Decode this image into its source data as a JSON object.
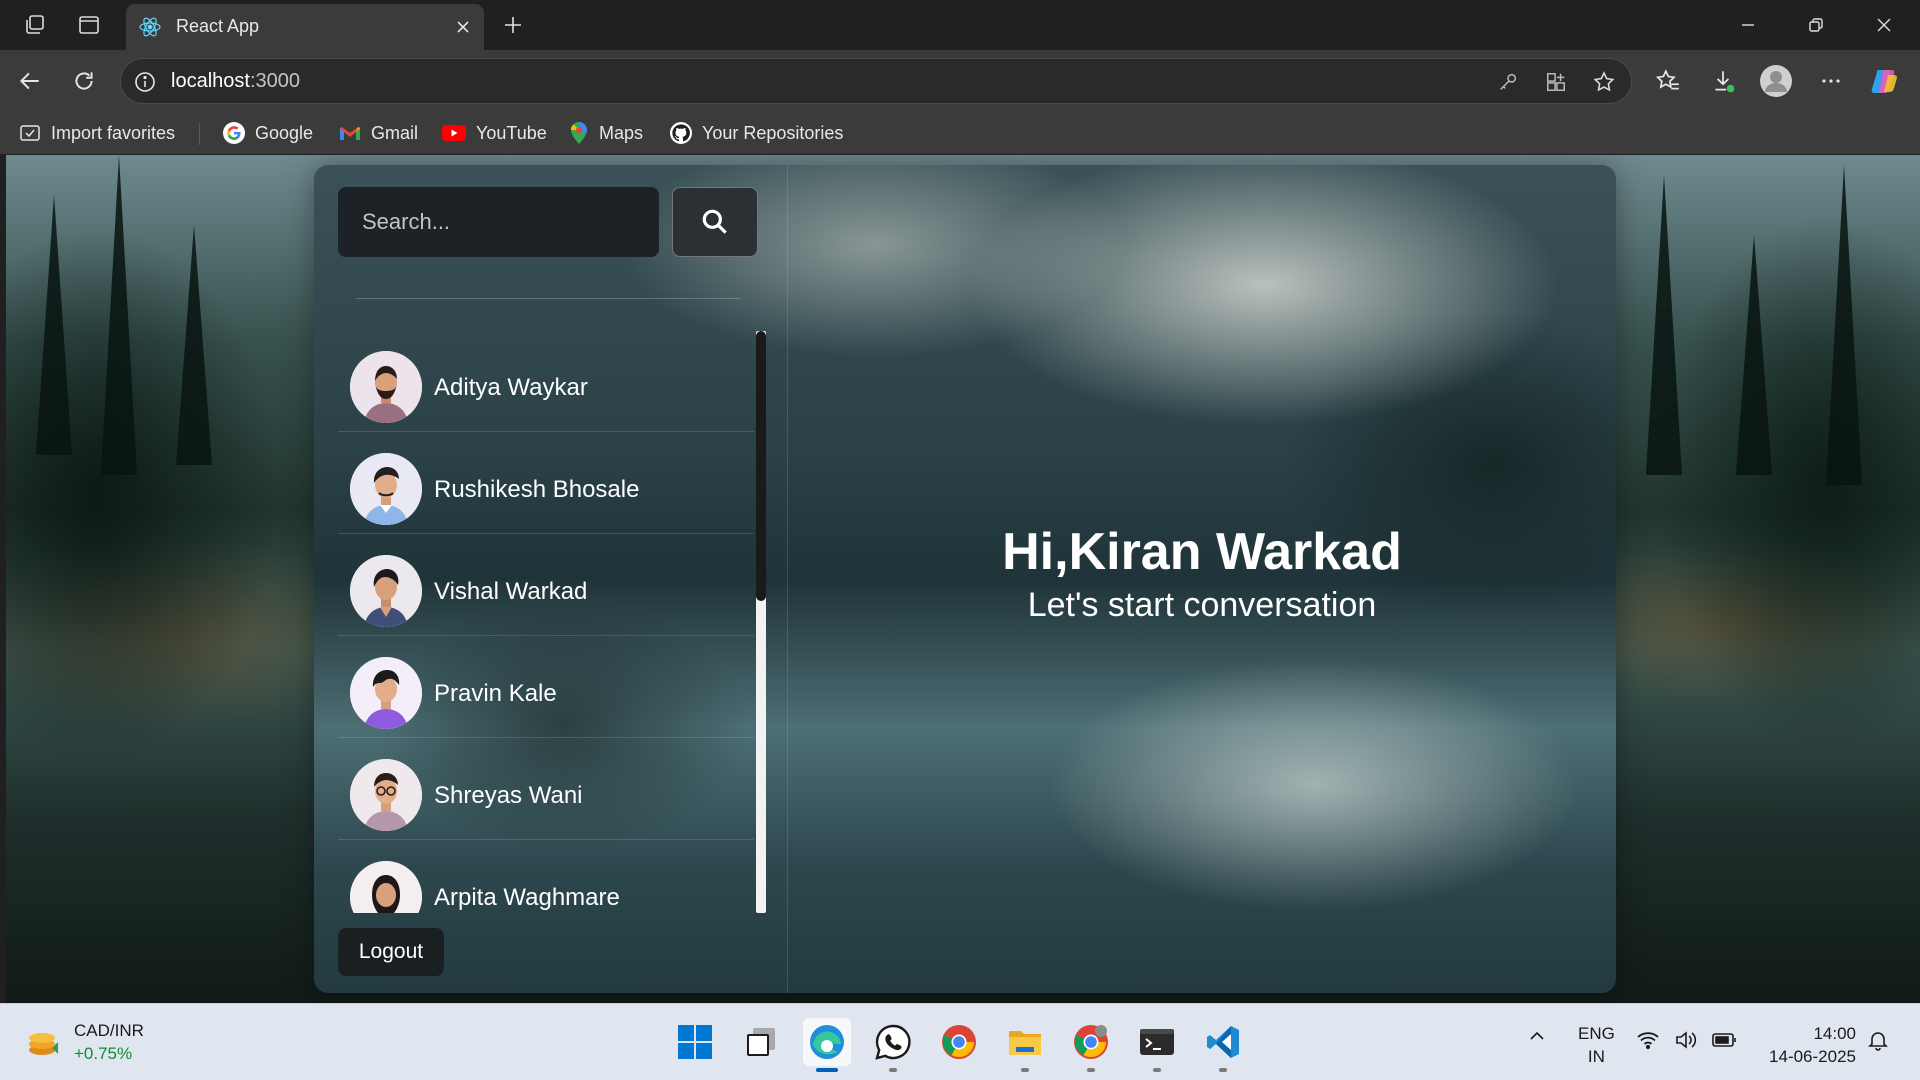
{
  "browser": {
    "tab_title": "React App",
    "url_host": "localhost",
    "url_port": ":3000",
    "bookmarks": [
      "Import favorites",
      "Google",
      "Gmail",
      "YouTube",
      "Maps",
      "Your Repositories"
    ]
  },
  "app": {
    "search_placeholder": "Search...",
    "contacts": [
      {
        "name": "Aditya Waykar"
      },
      {
        "name": "Rushikesh Bhosale"
      },
      {
        "name": "Vishal Warkad"
      },
      {
        "name": "Pravin Kale"
      },
      {
        "name": "Shreyas Wani"
      },
      {
        "name": "Arpita Waghmare"
      }
    ],
    "logout_label": "Logout",
    "greeting": "Hi,Kiran Warkad",
    "subtitle": "Let's start conversation"
  },
  "taskbar": {
    "ticker_symbol": "CAD/INR",
    "ticker_change": "+0.75%",
    "lang_line1": "ENG",
    "lang_line2": "IN",
    "time": "14:00",
    "date": "14-06-2025",
    "apps": [
      "start-icon",
      "task-view-icon",
      "edge-icon",
      "whatsapp-icon",
      "chrome-icon",
      "file-explorer-icon",
      "chrome-profile-icon",
      "terminal-icon",
      "vscode-icon"
    ]
  },
  "colors": {
    "accent": "#005fb8",
    "ticker_positive": "#138a36"
  }
}
